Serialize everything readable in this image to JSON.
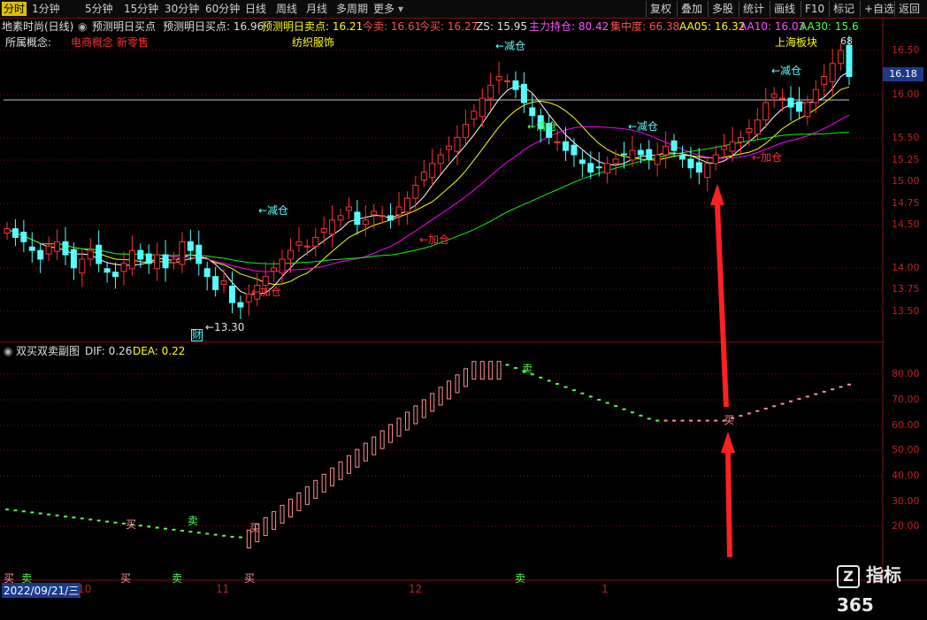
{
  "toolbar": {
    "periods": [
      "分时",
      "1分钟",
      "5分钟",
      "15分钟",
      "30分钟",
      "60分钟",
      "日线",
      "周线",
      "月线",
      "多周期",
      "更多"
    ],
    "active": "分时",
    "right_buttons": [
      "复权",
      "叠加",
      "多股",
      "统计",
      "画线",
      "F10",
      "标记",
      "+自选",
      "返回"
    ]
  },
  "info1": {
    "stock": "地素时尚(日线)",
    "indicator": "预测明日买点",
    "buy_label": "预测明日买点: 16.96",
    "sell_label": "预测明日卖点: 16.21",
    "today_sell": "今卖: 16.61",
    "today_buy": "今买: 16.27",
    "zs": "ZS: 15.95",
    "main_pos": "主力持仓: 80.42",
    "concentration": "集中度: 66.38",
    "aa05": "AA05: 16.32",
    "aa10": "AA10: 16.03",
    "aa30": "AA30: 15.6"
  },
  "info2": {
    "concept_label": "所属概念:",
    "concepts": "电商概念 新零售",
    "industry": "纺织服饰",
    "region": "上海板块"
  },
  "price_axis": [
    "16.50",
    "16.00",
    "15.50",
    "15.25",
    "15.00",
    "14.75",
    "14.50",
    "14.00",
    "13.75",
    "13.50"
  ],
  "current_price": "16.18",
  "annotations": {
    "reduce": "←减仓",
    "add": "←加仓",
    "clear": "←清仓",
    "low": "←13.30",
    "high": "68",
    "fin": "财"
  },
  "sub": {
    "title": "双买双卖副图",
    "dif": "DIF: 0.26",
    "dea": "DEA: 0.22",
    "axis": [
      "80.00",
      "70.00",
      "60.00",
      "50.00",
      "40.00",
      "30.00",
      "20.00"
    ],
    "buy": "买",
    "sell": "卖"
  },
  "datebar": {
    "date": "2022/09/21/三",
    "months": [
      "10",
      "11",
      "12",
      "1"
    ]
  },
  "watermark": "指标365",
  "colors": {
    "up": "#ff3232",
    "down": "#54ffff",
    "ma5": "#ffffff",
    "ma10": "#ffff00",
    "ma20": "#ff00ff",
    "ma60": "#00ff00",
    "grid": "#7a1010"
  }
}
